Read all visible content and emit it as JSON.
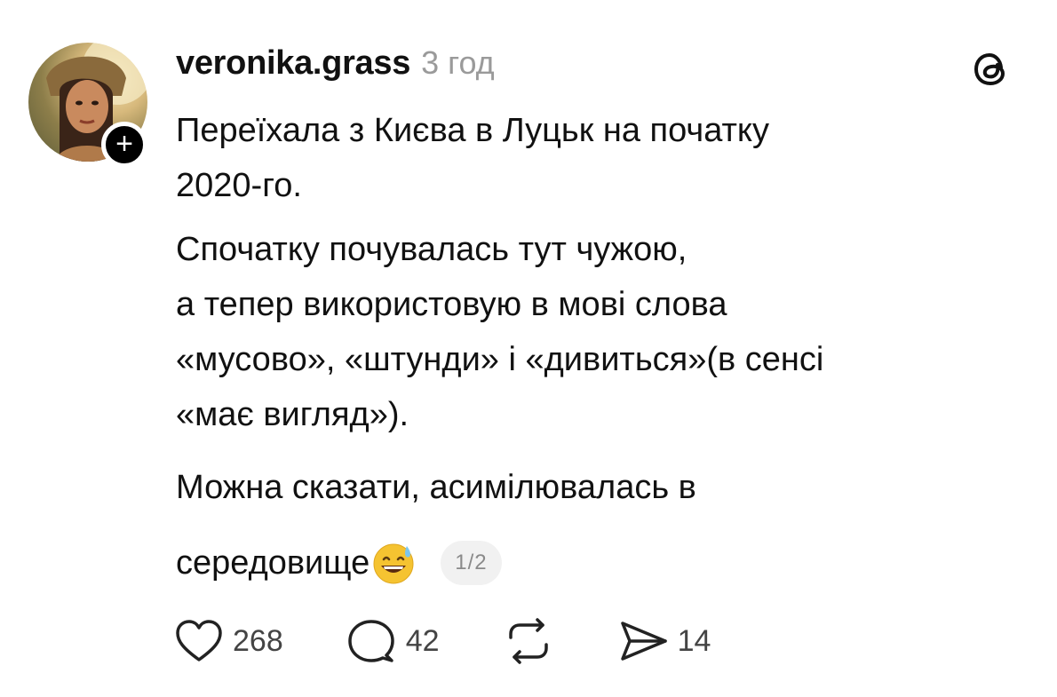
{
  "post": {
    "username": "veronika.grass",
    "time": "3 год",
    "lines": [
      "Переїхала з Києва в Луцьк на початку",
      "2020-го.",
      "Спочатку почувалась тут чужою,",
      "а тепер використовую в мові слова",
      "«мусово», «штунди» і «дивиться»(в сенсі",
      "«має вигляд»).",
      "Можна сказати, асимілювалась в"
    ],
    "last_line": "середовище",
    "emoji": "grinning-sweat-emoji",
    "counter": "1/2"
  },
  "actions": {
    "likes": "268",
    "replies": "42",
    "shares": "14"
  },
  "icons": {
    "follow": "plus-icon",
    "app": "threads-logo-icon",
    "like": "heart-icon",
    "reply": "speech-bubble-icon",
    "repost": "repost-icon",
    "share": "send-icon"
  }
}
